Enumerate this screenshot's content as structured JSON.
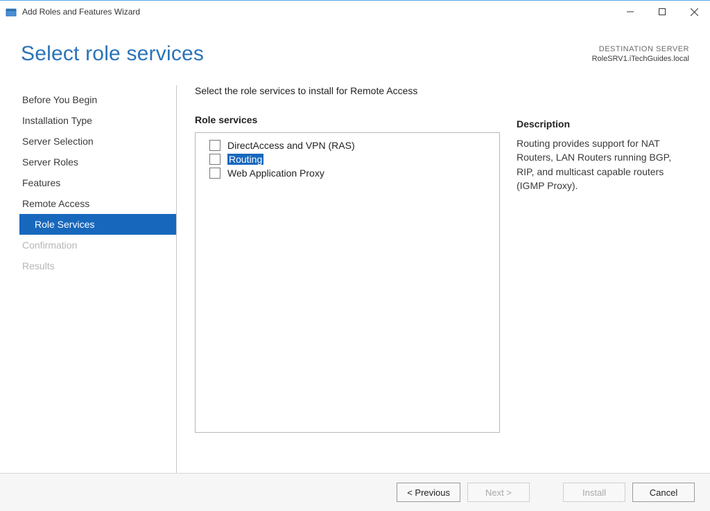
{
  "window": {
    "title": "Add Roles and Features Wizard"
  },
  "header": {
    "page_title": "Select role services",
    "destination_label": "DESTINATION SERVER",
    "destination_server": "RoleSRV1.iTechGuides.local"
  },
  "sidebar": {
    "items": [
      {
        "label": "Before You Begin",
        "state": "normal"
      },
      {
        "label": "Installation Type",
        "state": "normal"
      },
      {
        "label": "Server Selection",
        "state": "normal"
      },
      {
        "label": "Server Roles",
        "state": "normal"
      },
      {
        "label": "Features",
        "state": "normal"
      },
      {
        "label": "Remote Access",
        "state": "normal"
      },
      {
        "label": "Role Services",
        "state": "selected"
      },
      {
        "label": "Confirmation",
        "state": "disabled"
      },
      {
        "label": "Results",
        "state": "disabled"
      }
    ]
  },
  "content": {
    "instruction": "Select the role services to install for Remote Access",
    "role_services_label": "Role services",
    "roles": [
      {
        "label": "DirectAccess and VPN (RAS)",
        "checked": false,
        "highlighted": false
      },
      {
        "label": "Routing",
        "checked": false,
        "highlighted": true
      },
      {
        "label": "Web Application Proxy",
        "checked": false,
        "highlighted": false
      }
    ],
    "description_label": "Description",
    "description_text": "Routing provides support for NAT Routers, LAN Routers running BGP, RIP, and multicast capable routers (IGMP Proxy)."
  },
  "footer": {
    "previous": "< Previous",
    "next": "Next >",
    "install": "Install",
    "cancel": "Cancel"
  }
}
